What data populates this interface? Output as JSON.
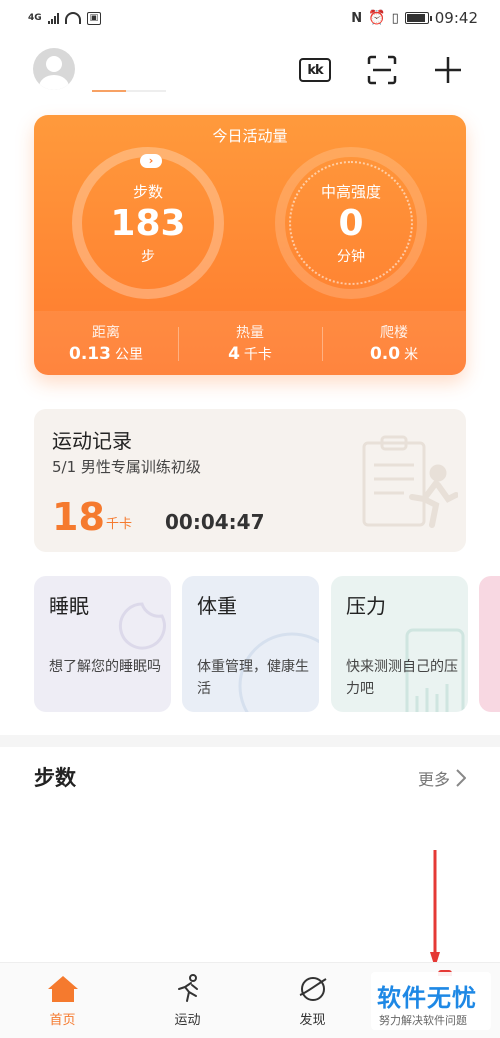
{
  "status_bar": {
    "network": "4G",
    "time": "09:42"
  },
  "activity": {
    "title": "今日活动量",
    "steps": {
      "label": "步数",
      "value": "183",
      "unit": "步"
    },
    "intensity": {
      "label": "中高强度",
      "value": "0",
      "unit": "分钟"
    },
    "metrics": [
      {
        "label": "距离",
        "value": "0.13",
        "unit": "公里"
      },
      {
        "label": "热量",
        "value": "4",
        "unit": "千卡"
      },
      {
        "label": "爬楼",
        "value": "0.0",
        "unit": "米"
      }
    ]
  },
  "record": {
    "title": "运动记录",
    "subtitle": "5/1  男性专属训练初级",
    "calories": "18",
    "calories_unit": "千卡",
    "duration": "00:04:47"
  },
  "cards": [
    {
      "title": "睡眠",
      "desc": "想了解您的睡眠吗"
    },
    {
      "title": "体重",
      "desc": "体重管理，健康生活"
    },
    {
      "title": "压力",
      "desc": "快来测测自己的压力吧"
    }
  ],
  "steps_section": {
    "title": "步数",
    "more": "更多"
  },
  "nav": [
    {
      "label": "首页",
      "icon": "home-icon"
    },
    {
      "label": "运动",
      "icon": "running-icon"
    },
    {
      "label": "发现",
      "icon": "discover-icon"
    }
  ],
  "watermark": {
    "main": "软件无忧",
    "sub": "努力解决软件问题"
  },
  "colors": {
    "accent": "#f57a2e",
    "annotation": "#e53935"
  }
}
